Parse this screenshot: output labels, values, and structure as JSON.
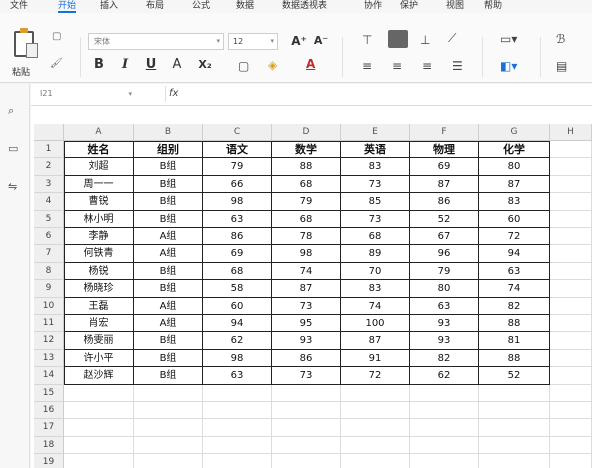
{
  "menu": [
    "文件",
    "开始",
    "插入",
    "布局",
    "公式",
    "数据",
    "数据透视表",
    "协作",
    "保护",
    "视图",
    "帮助"
  ],
  "menu_active_index": 1,
  "ribbon": {
    "paste_label": "粘贴",
    "font_name": "宋体",
    "font_size": "12",
    "bold": "B",
    "italic": "I",
    "underline": "U",
    "strike": "A",
    "subscript": "X₂",
    "grow_font": "A⁺",
    "shrink_font": "A⁻"
  },
  "formula_bar": {
    "name_box": "I21",
    "fx": "fx",
    "formula": ""
  },
  "columns": [
    "A",
    "B",
    "C",
    "D",
    "E",
    "F",
    "G",
    "H"
  ],
  "rows": [
    "1",
    "2",
    "3",
    "4",
    "5",
    "6",
    "7",
    "8",
    "9",
    "10",
    "11",
    "12",
    "13",
    "14",
    "15",
    "16",
    "17",
    "18",
    "19"
  ],
  "table": {
    "header": [
      "姓名",
      "组别",
      "语文",
      "数学",
      "英语",
      "物理",
      "化学"
    ],
    "body": [
      [
        "刘超",
        "B组",
        "79",
        "88",
        "83",
        "69",
        "80"
      ],
      [
        "周一一",
        "B组",
        "66",
        "68",
        "73",
        "87",
        "87"
      ],
      [
        "曹锐",
        "B组",
        "98",
        "79",
        "85",
        "86",
        "83"
      ],
      [
        "林小明",
        "B组",
        "63",
        "68",
        "73",
        "52",
        "60"
      ],
      [
        "李静",
        "A组",
        "86",
        "78",
        "68",
        "67",
        "72"
      ],
      [
        "何铁青",
        "A组",
        "69",
        "98",
        "89",
        "96",
        "94"
      ],
      [
        "杨锐",
        "B组",
        "68",
        "74",
        "70",
        "79",
        "63"
      ],
      [
        "杨晓珍",
        "B组",
        "58",
        "87",
        "83",
        "80",
        "74"
      ],
      [
        "王磊",
        "A组",
        "60",
        "73",
        "74",
        "63",
        "82"
      ],
      [
        "肖宏",
        "A组",
        "94",
        "95",
        "100",
        "93",
        "88"
      ],
      [
        "杨雯丽",
        "B组",
        "62",
        "93",
        "87",
        "93",
        "81"
      ],
      [
        "许小平",
        "B组",
        "98",
        "86",
        "91",
        "82",
        "88"
      ],
      [
        "赵沙辉",
        "B组",
        "63",
        "73",
        "72",
        "62",
        "52"
      ]
    ]
  }
}
